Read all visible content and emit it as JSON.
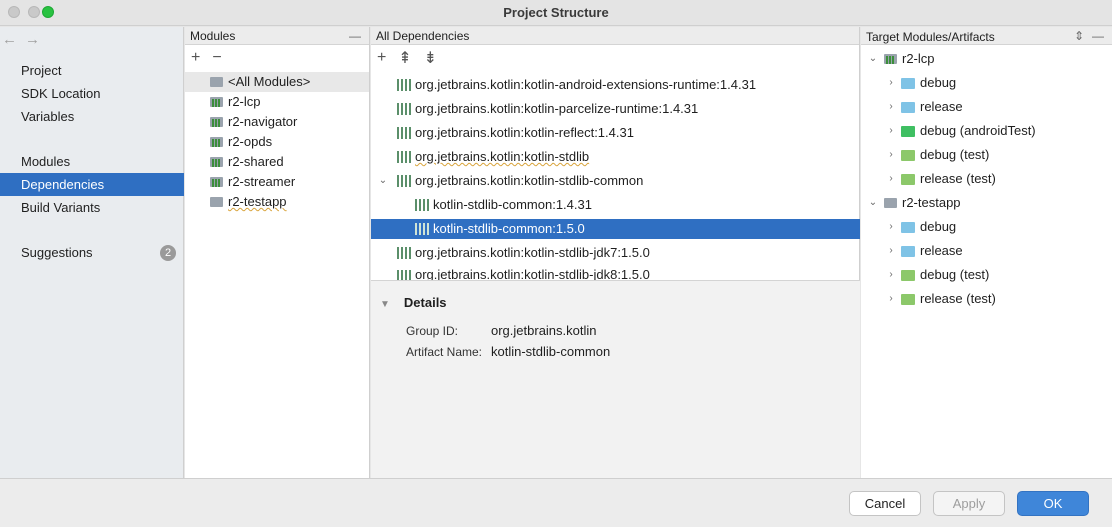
{
  "window": {
    "title": "Project Structure"
  },
  "nav": {
    "back_icon": "←",
    "forward_icon": "→",
    "items": [
      {
        "label": "Project"
      },
      {
        "label": "SDK Location"
      },
      {
        "label": "Variables"
      },
      {
        "label": "Modules"
      },
      {
        "label": "Dependencies"
      },
      {
        "label": "Build Variants"
      },
      {
        "label": "Suggestions",
        "badge": "2"
      }
    ]
  },
  "modules_panel": {
    "header": "Modules",
    "collapse": "—",
    "add": "+",
    "remove": "−",
    "items": [
      {
        "label": "<All Modules>"
      },
      {
        "label": "r2-lcp"
      },
      {
        "label": "r2-navigator"
      },
      {
        "label": "r2-opds"
      },
      {
        "label": "r2-shared"
      },
      {
        "label": "r2-streamer"
      },
      {
        "label": "r2-testapp"
      }
    ]
  },
  "deps_panel": {
    "header": "All Dependencies",
    "add": "+",
    "expand_all": "⇞",
    "collapse_all": "⇟",
    "items": [
      {
        "label": "org.jetbrains.kotlin:kotlin-android-extensions-runtime:1.4.31"
      },
      {
        "label": "org.jetbrains.kotlin:kotlin-parcelize-runtime:1.4.31"
      },
      {
        "label": "org.jetbrains.kotlin:kotlin-reflect:1.4.31"
      },
      {
        "label": "org.jetbrains.kotlin:kotlin-stdlib"
      },
      {
        "label": "org.jetbrains.kotlin:kotlin-stdlib-common"
      },
      {
        "label": "kotlin-stdlib-common:1.4.31"
      },
      {
        "label": "kotlin-stdlib-common:1.5.0"
      },
      {
        "label": "org.jetbrains.kotlin:kotlin-stdlib-jdk7:1.5.0"
      },
      {
        "label": "org.jetbrains.kotlin:kotlin-stdlib-jdk8:1.5.0"
      }
    ],
    "details": {
      "title": "Details",
      "group_label": "Group ID:",
      "group_value": "org.jetbrains.kotlin",
      "artifact_label": "Artifact Name:",
      "artifact_value": "kotlin-stdlib-common"
    }
  },
  "targets_panel": {
    "header": "Target Modules/Artifacts",
    "items": [
      {
        "label": "r2-lcp"
      },
      {
        "label": "debug"
      },
      {
        "label": "release"
      },
      {
        "label": "debug (androidTest)"
      },
      {
        "label": "debug (test)"
      },
      {
        "label": "release (test)"
      },
      {
        "label": "r2-testapp"
      },
      {
        "label": "debug"
      },
      {
        "label": "release"
      },
      {
        "label": "debug (test)"
      },
      {
        "label": "release (test)"
      }
    ]
  },
  "buttons": {
    "cancel": "Cancel",
    "apply": "Apply",
    "ok": "OK"
  }
}
